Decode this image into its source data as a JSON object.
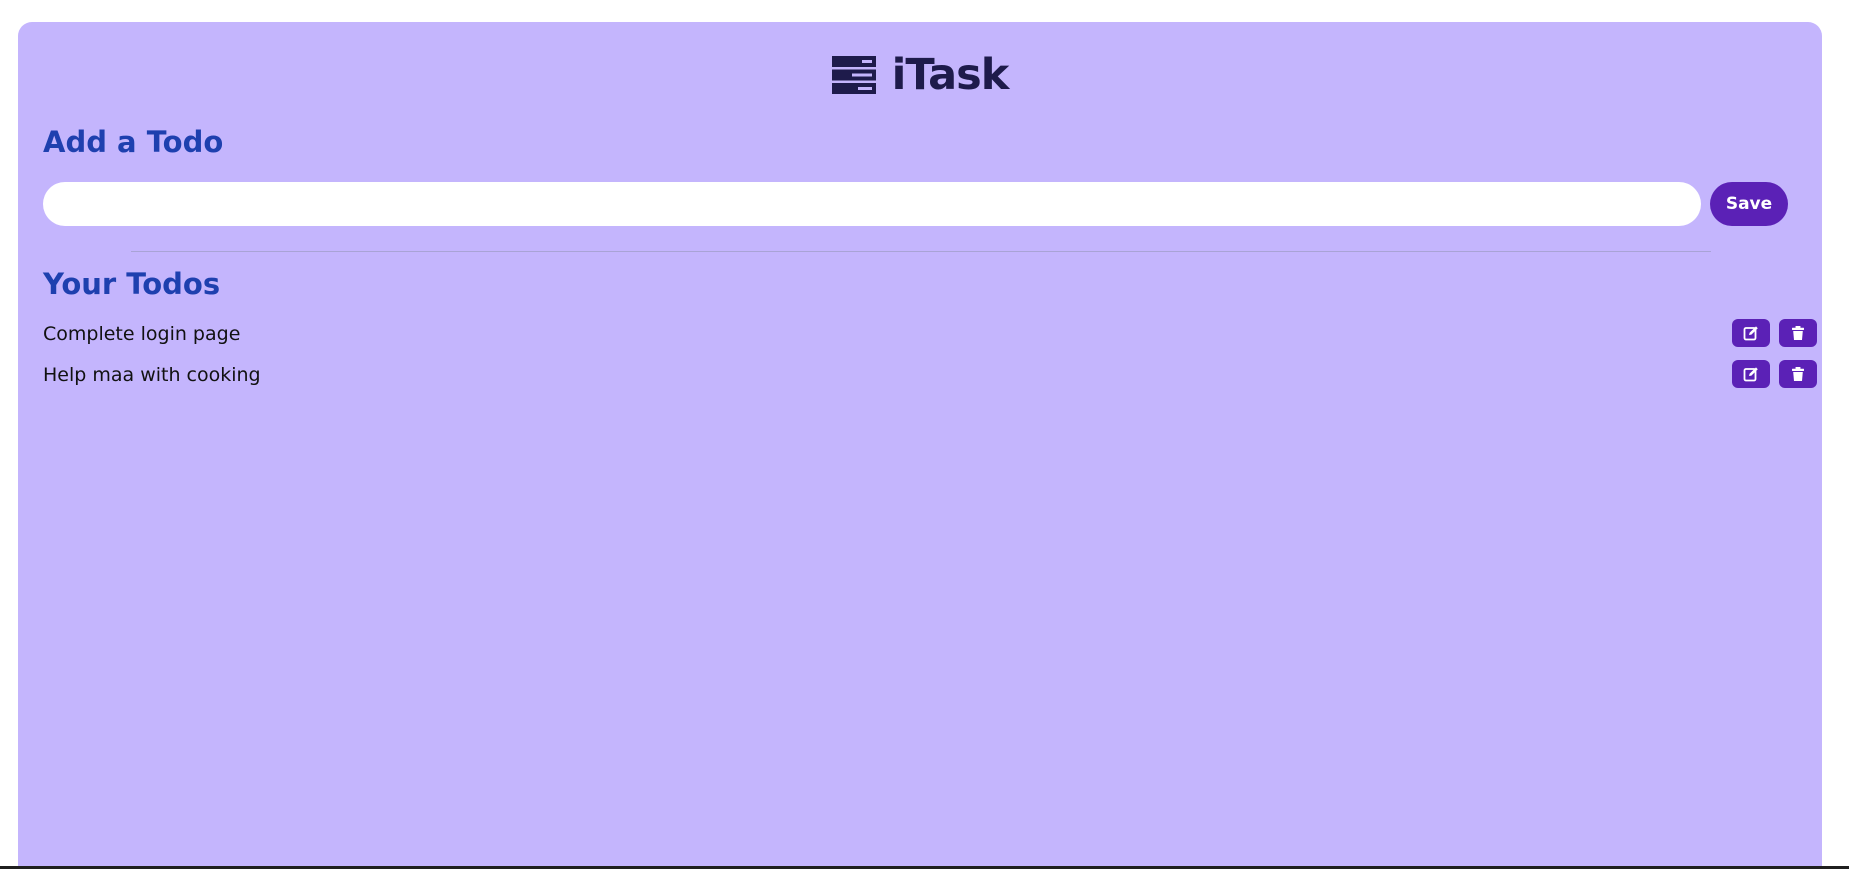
{
  "brand": {
    "name": "iTask",
    "logo_icon": "stacked-tasks-icon"
  },
  "add_section": {
    "heading": "Add a Todo",
    "input": {
      "value": "",
      "placeholder": ""
    },
    "save_label": "Save"
  },
  "list_section": {
    "heading": "Your Todos",
    "todos": [
      {
        "text": "Complete login page",
        "edit_icon": "edit-icon",
        "delete_icon": "trash-icon"
      },
      {
        "text": "Help maa with cooking",
        "edit_icon": "edit-icon",
        "delete_icon": "trash-icon"
      }
    ]
  },
  "colors": {
    "card_background": "#c4b5fd",
    "accent": "#5b21b6",
    "heading": "#1e40af",
    "brand_text": "#1e1b4b"
  }
}
